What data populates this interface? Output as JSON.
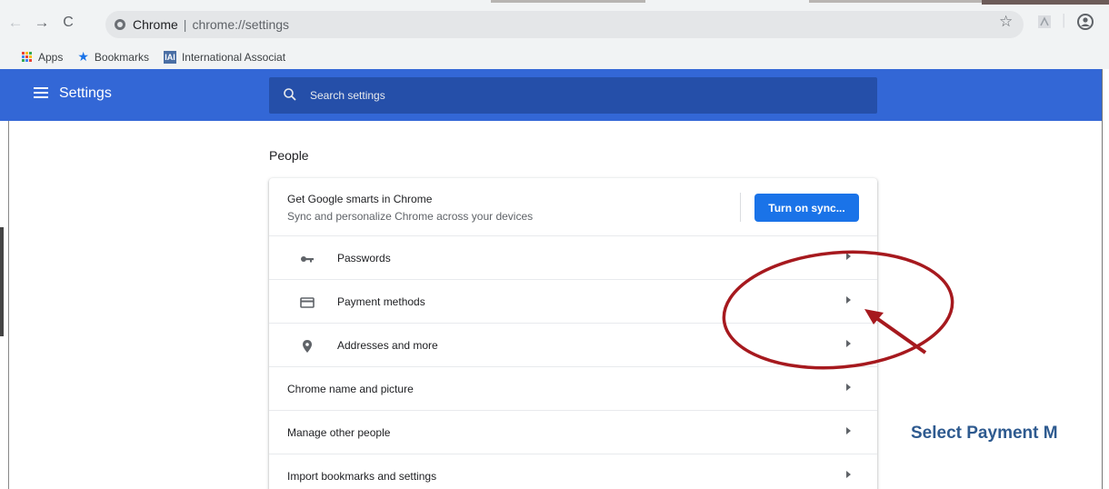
{
  "browser": {
    "site_label": "Chrome",
    "url": "chrome://settings",
    "bookmarks": [
      {
        "label": "Apps"
      },
      {
        "label": "Bookmarks"
      },
      {
        "label": "International Associat"
      }
    ]
  },
  "header": {
    "title": "Settings",
    "search_placeholder": "Search settings"
  },
  "people": {
    "section_title": "People",
    "sync_title": "Get Google smarts in Chrome",
    "sync_subtitle": "Sync and personalize Chrome across your devices",
    "sync_button": "Turn on sync...",
    "autofill_items": [
      {
        "label": "Passwords",
        "icon": "key-icon"
      },
      {
        "label": "Payment methods",
        "icon": "credit-card-icon"
      },
      {
        "label": "Addresses and more",
        "icon": "location-pin-icon"
      }
    ],
    "items": [
      {
        "label": "Chrome name and picture"
      },
      {
        "label": "Manage other people"
      },
      {
        "label": "Import bookmarks and settings"
      }
    ]
  },
  "annotation": {
    "text": "Select Payment M",
    "color": "#a6191e"
  },
  "colors": {
    "header_blue": "#3367d6",
    "button_blue": "#1a73e8"
  }
}
